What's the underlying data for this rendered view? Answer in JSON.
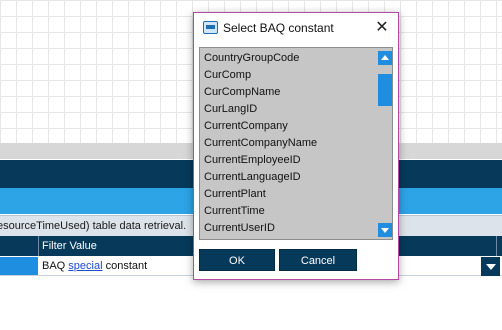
{
  "background": {
    "info_text": "esourceTimeUsed)  table data retrieval.",
    "grid": {
      "column_header": "Filter Value",
      "row": {
        "prefix": "BAQ",
        "link": "special",
        "suffix": "constant"
      }
    }
  },
  "dialog": {
    "title": "Select BAQ constant",
    "items": [
      "CountryGroupCode",
      "CurComp",
      "CurCompName",
      "CurLangID",
      "CurrentCompany",
      "CurrentCompanyName",
      "CurrentEmployeeID",
      "CurrentLanguageID",
      "CurrentPlant",
      "CurrentTime",
      "CurrentUserID"
    ],
    "ok_label": "OK",
    "cancel_label": "Cancel",
    "close_glyph": "✕"
  },
  "colors": {
    "dark_navy": "#073a5a",
    "accent_blue": "#1f8de0",
    "sky_blue": "#2da4e6",
    "dialog_border": "#b24aa4",
    "list_bg": "#c6c6c6"
  }
}
